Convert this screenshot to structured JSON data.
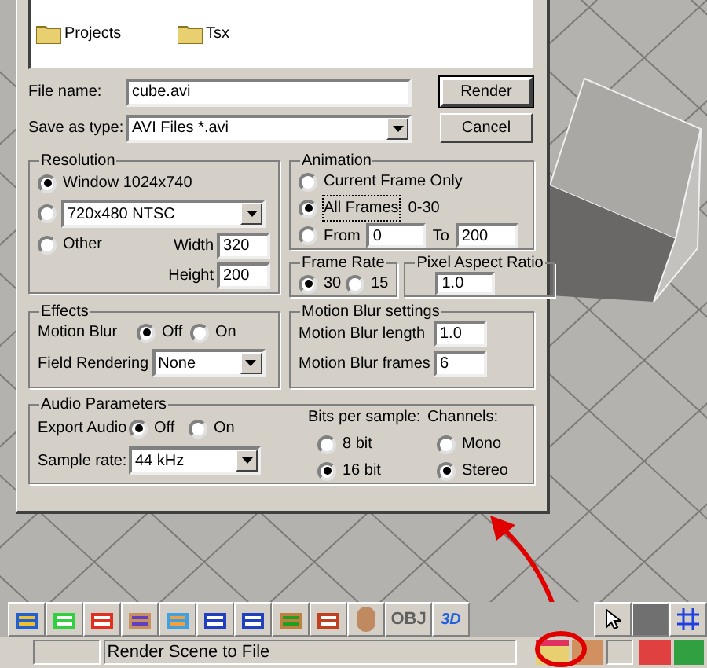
{
  "file_list": {
    "items": [
      {
        "name": "Projects"
      },
      {
        "name": "Tsx"
      }
    ]
  },
  "file_name": {
    "label": "File name:",
    "value": "cube.avi"
  },
  "save_as_type": {
    "label": "Save as type:",
    "value": "AVI Files *.avi"
  },
  "buttons": [
    {
      "label": "Render",
      "default": true
    },
    {
      "label": "Cancel",
      "default": false
    }
  ],
  "resolution": {
    "title": "Resolution",
    "options": [
      {
        "kind": "text",
        "label": "Window  1024x740",
        "selected": true
      },
      {
        "kind": "dropdown",
        "value": "720x480 NTSC",
        "selected": false
      },
      {
        "kind": "text",
        "label": "Other",
        "selected": false
      }
    ],
    "width": {
      "label": "Width",
      "value": "320"
    },
    "height": {
      "label": "Height",
      "value": "200"
    }
  },
  "animation": {
    "title": "Animation",
    "options": [
      {
        "kind": "text",
        "label": "Current Frame Only",
        "selected": false
      },
      {
        "kind": "note",
        "label": "All Frames",
        "note": "0-30",
        "selected": true,
        "focused": true
      },
      {
        "kind": "range",
        "label": "From",
        "from": "0",
        "to_label": "To",
        "to": "200",
        "selected": false
      }
    ]
  },
  "frame_rate": {
    "title": "Frame Rate",
    "options": [
      {
        "label": "30",
        "selected": true
      },
      {
        "label": "15",
        "selected": false
      }
    ]
  },
  "pixel_aspect_ratio": {
    "title": "Pixel Aspect Ratio",
    "value": "1.0"
  },
  "effects": {
    "title": "Effects",
    "motion_blur": {
      "label": "Motion Blur",
      "options": [
        {
          "label": "Off",
          "selected": true
        },
        {
          "label": "On",
          "selected": false
        }
      ]
    },
    "field_rendering": {
      "label": "Field Rendering",
      "value": "None"
    }
  },
  "motion_blur_settings": {
    "title": "Motion Blur settings",
    "fields": [
      {
        "label": "Motion Blur length",
        "value": "1.0"
      },
      {
        "label": "Motion Blur frames",
        "value": "6"
      }
    ]
  },
  "audio": {
    "title": "Audio Parameters",
    "export_audio": {
      "label": "Export Audio",
      "options": [
        {
          "label": "Off",
          "selected": true
        },
        {
          "label": "On",
          "selected": false
        }
      ]
    },
    "sample_rate": {
      "label": "Sample rate:",
      "value": "44 kHz"
    },
    "bits": {
      "title": "Bits per sample:",
      "options": [
        {
          "label": "8 bit",
          "selected": false
        },
        {
          "label": "16 bit",
          "selected": true
        }
      ]
    },
    "channels": {
      "title": "Channels:",
      "options": [
        {
          "label": "Mono",
          "selected": false
        },
        {
          "label": "Stereo",
          "selected": true
        }
      ]
    }
  },
  "toolbar": {
    "obj_label": "OBJ",
    "badge_3d": "3D"
  },
  "status_bar": {
    "text": "Render Scene to File"
  }
}
